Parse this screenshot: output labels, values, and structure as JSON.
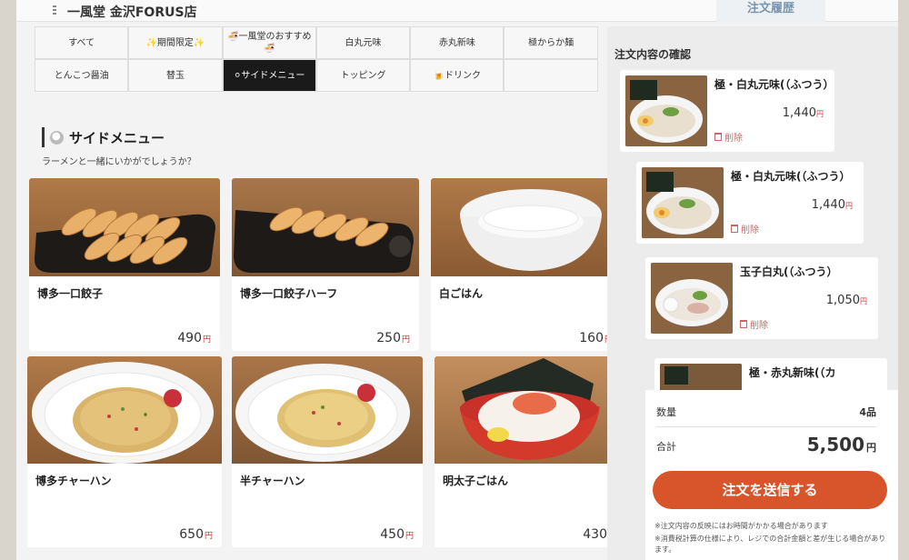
{
  "header": {
    "store_name": "一風堂 金沢FORUS店",
    "history_label": "注文履歴"
  },
  "categories": [
    {
      "label": "すべて"
    },
    {
      "label": "✨期間限定✨"
    },
    {
      "label": "🍜一風堂のおすすめ🍜"
    },
    {
      "label": "白丸元味"
    },
    {
      "label": "赤丸新味"
    },
    {
      "label": "極からか麺"
    },
    {
      "label": "とんこつ醤油"
    },
    {
      "label": "替玉"
    },
    {
      "label": "⚪サイドメニュー",
      "active": true
    },
    {
      "label": "トッピング"
    },
    {
      "label": "🍺ドリンク"
    }
  ],
  "section": {
    "title": "サイドメニュー",
    "subtitle": "ラーメンと一緒にいかがでしょうか？"
  },
  "products": [
    {
      "name": "博多一口餃子",
      "price": "490",
      "image": "gyoza-plate"
    },
    {
      "name": "博多一口餃子ハーフ",
      "price": "250",
      "image": "gyoza-half"
    },
    {
      "name": "白ごはん",
      "price": "160",
      "image": "white-rice"
    },
    {
      "name": "博多チャーハン",
      "price": "650",
      "image": "fried-rice"
    },
    {
      "name": "半チャーハン",
      "price": "450",
      "image": "half-fried-rice"
    },
    {
      "name": "明太子ごはん",
      "price": "430",
      "image": "mentaiko-rice"
    }
  ],
  "currency": "円",
  "order": {
    "title": "注文内容の確認",
    "delete_label": "削除",
    "items": [
      {
        "name": "極・白丸元味(（ふつう）",
        "price": "1,440"
      },
      {
        "name": "極・白丸元味(（ふつう）",
        "price": "1,440"
      },
      {
        "name": "玉子白丸(（ふつう）",
        "price": "1,050"
      },
      {
        "name": "極・赤丸新味(（カ",
        "price": ""
      }
    ]
  },
  "summary": {
    "qty_label": "数量",
    "qty_value": "4品",
    "total_label": "合計",
    "total_value": "5,500",
    "submit_label": "注文を送信する",
    "note1": "※注文内容の反映にはお時間がかかる場合があります",
    "note2": "※消費税計算の仕様により、レジでの合計金額と差が生じる場合があります。"
  },
  "colors": {
    "accent": "#d8552b",
    "active_category": "#1a1a1a",
    "yen": "#cc3333"
  }
}
